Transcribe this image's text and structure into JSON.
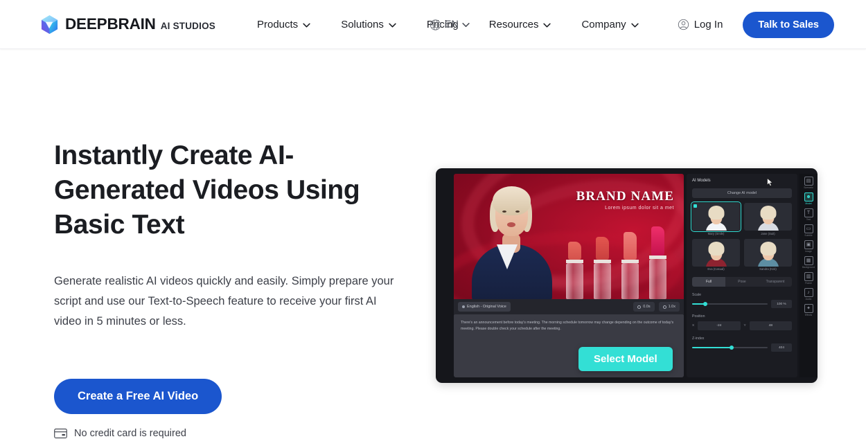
{
  "brand": {
    "name": "DEEPBRAIN",
    "suffix": "AI STUDIOS",
    "logo_icon": "cube-logo-icon"
  },
  "colors": {
    "primary_blue": "#1b56ce",
    "accent_teal": "#33dfd5",
    "text_dark": "#1b1d22",
    "text_body": "#3d4049"
  },
  "header": {
    "nav": [
      {
        "label": "Products",
        "has_dropdown": true
      },
      {
        "label": "Solutions",
        "has_dropdown": true
      },
      {
        "label": "Pricing",
        "has_dropdown": false
      },
      {
        "label": "Resources",
        "has_dropdown": true
      },
      {
        "label": "Company",
        "has_dropdown": true
      }
    ],
    "language": {
      "label": "EN",
      "icon": "globe-icon"
    },
    "login": {
      "label": "Log In",
      "icon": "user-circle-icon"
    },
    "cta": {
      "label": "Talk to Sales"
    }
  },
  "hero": {
    "title": "Instantly Create AI-Generated Videos Using Basic Text",
    "subtitle": "Generate realistic AI videos quickly and easily. Simply prepare your script and use our Text-to-Speech feature to receive your first AI video in 5 minutes or less.",
    "cta": {
      "label": "Create a Free AI Video"
    },
    "note": {
      "label": "No credit card is required",
      "icon": "credit-card-icon"
    }
  },
  "demo": {
    "canvas": {
      "brand_name": "BRAND NAME",
      "brand_tagline": "Lorem ipsum dolor sit a met"
    },
    "toolbar": {
      "voice_chip": "English - Original Voice",
      "duration": "0.0s",
      "speed": "1.0x"
    },
    "script": "There's an announcement before today's meeting. The morning schedule tomorrow may change depending on the outcome of today's meeting. Please double check your schedule after the meeting.",
    "select_button": "Select Model",
    "panel": {
      "title": "AI Models",
      "change_button": "Change AI model",
      "models": [
        {
          "name": "Mary (Smile)",
          "selected": true,
          "outfit": "#f2f4f7"
        },
        {
          "name": "Jane (Suit)",
          "selected": false,
          "outfit": "#d8dbe2"
        },
        {
          "name": "Eva (Casual)",
          "selected": false,
          "outfit": "#8e2330"
        },
        {
          "name": "Sandra (Knit)",
          "selected": false,
          "outfit": "#5d8ea3"
        }
      ],
      "tabs": [
        {
          "label": "Full",
          "active": true
        },
        {
          "label": "Pose",
          "active": false
        },
        {
          "label": "Transparent",
          "active": false
        }
      ],
      "scale": {
        "label": "Scale",
        "value": "100 %",
        "percent": 17
      },
      "position": {
        "label": "Position",
        "x_axis": "X",
        "x_value": "-24",
        "y_axis": "Y",
        "y_value": "48"
      },
      "zindex": {
        "label": "Z-index",
        "value": "404",
        "percent": 52
      }
    },
    "rail": [
      {
        "label": "Scenario",
        "glyph": "▤",
        "active": false
      },
      {
        "label": "Model",
        "glyph": "☻",
        "active": true
      },
      {
        "label": "Text",
        "glyph": "T",
        "active": false
      },
      {
        "label": "Subtitle",
        "glyph": "▭",
        "active": false
      },
      {
        "label": "Image",
        "glyph": "▣",
        "active": false
      },
      {
        "label": "Background",
        "glyph": "▦",
        "active": false
      },
      {
        "label": "Frame",
        "glyph": "▥",
        "active": false
      },
      {
        "label": "Audio",
        "glyph": "♪",
        "active": false
      },
      {
        "label": "Effects",
        "glyph": "✦",
        "active": false
      }
    ]
  }
}
